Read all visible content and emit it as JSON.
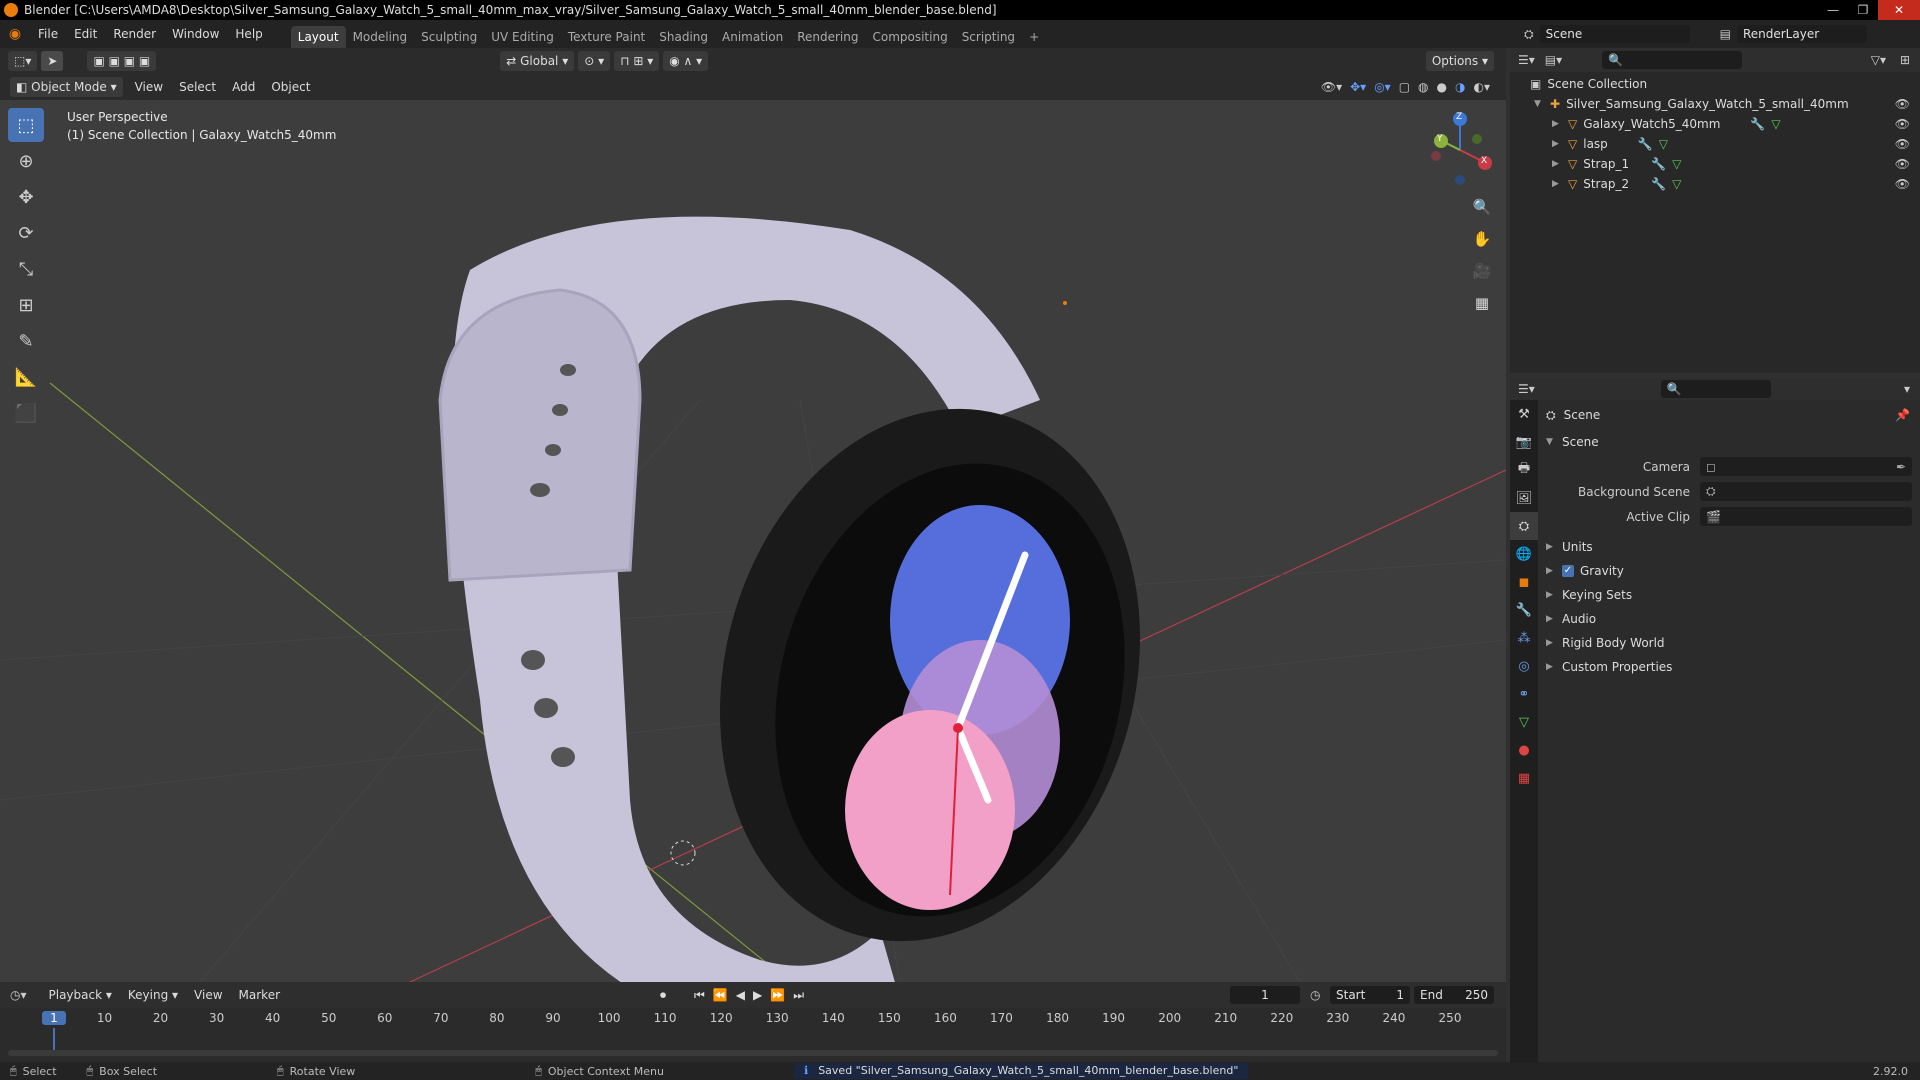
{
  "window": {
    "title": "Blender [C:\\Users\\AMDA8\\Desktop\\Silver_Samsung_Galaxy_Watch_5_small_40mm_max_vray/Silver_Samsung_Galaxy_Watch_5_small_40mm_blender_base.blend]",
    "controls": [
      "—",
      "❐",
      "✕"
    ]
  },
  "menus": [
    "File",
    "Edit",
    "Render",
    "Window",
    "Help"
  ],
  "workspaces": [
    "Layout",
    "Modeling",
    "Sculpting",
    "UV Editing",
    "Texture Paint",
    "Shading",
    "Animation",
    "Rendering",
    "Compositing",
    "Scripting"
  ],
  "workspace_add": "+",
  "scene_field": "Scene",
  "renderlayer_field": "RenderLayer",
  "viewport": {
    "orientation": "Global",
    "options": "Options",
    "mode": "Object Mode",
    "menus": [
      "View",
      "Select",
      "Add",
      "Object"
    ],
    "info_line1": "User Perspective",
    "info_line2": "(1) Scene Collection | Galaxy_Watch5_40mm"
  },
  "gizmo": {
    "x": "X",
    "y": "Y",
    "z": "Z"
  },
  "outliner": {
    "root": "Scene Collection",
    "collection": "Silver_Samsung_Galaxy_Watch_5_small_40mm",
    "objects": [
      "Galaxy_Watch5_40mm",
      "lasp",
      "Strap_1",
      "Strap_2"
    ]
  },
  "properties": {
    "context": "Scene",
    "panel": "Scene",
    "fields": [
      {
        "label": "Camera"
      },
      {
        "label": "Background Scene"
      },
      {
        "label": "Active Clip"
      }
    ],
    "subpanels": [
      "Units",
      "Gravity",
      "Keying Sets",
      "Audio",
      "Rigid Body World",
      "Custom Properties"
    ]
  },
  "timeline": {
    "menus": [
      "Playback",
      "Keying",
      "View",
      "Marker"
    ],
    "current_frame": "1",
    "start_label": "Start",
    "start": "1",
    "end_label": "End",
    "end": "250",
    "ticks": [
      "1",
      "10",
      "20",
      "30",
      "40",
      "50",
      "60",
      "70",
      "80",
      "90",
      "100",
      "110",
      "120",
      "130",
      "140",
      "150",
      "160",
      "170",
      "180",
      "190",
      "200",
      "210",
      "220",
      "230",
      "240",
      "250"
    ]
  },
  "statusbar": {
    "select": "Select",
    "box_select": "Box Select",
    "rotate": "Rotate View",
    "context_menu": "Object Context Menu",
    "message": "Saved \"Silver_Samsung_Galaxy_Watch_5_small_40mm_blender_base.blend\"",
    "version": "2.92.0"
  },
  "colors": {
    "accent": "#4772b3",
    "orange": "#e87d0d",
    "x_axis": "#c83c46",
    "y_axis": "#8cb43c",
    "z_axis": "#3c78d8"
  }
}
